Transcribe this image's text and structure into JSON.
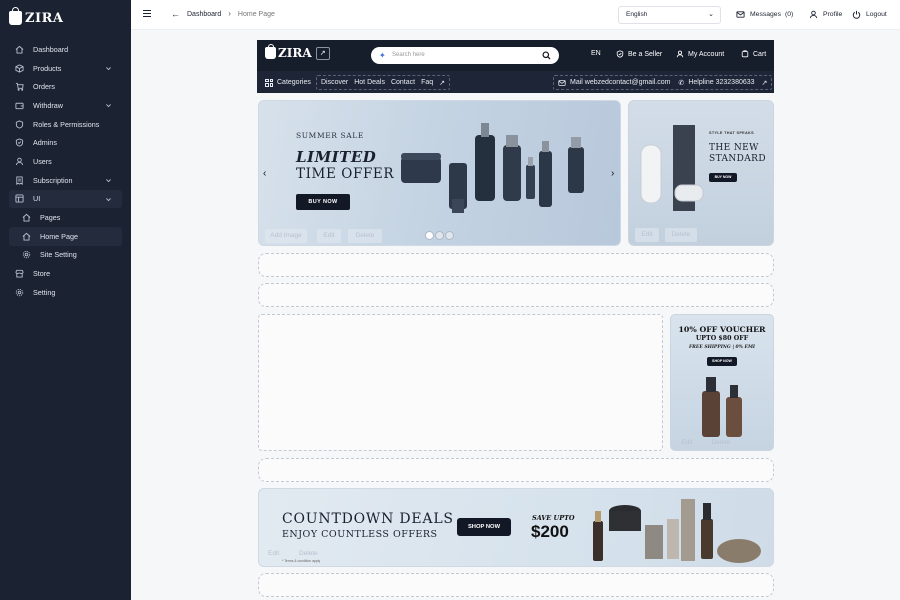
{
  "sidebar": {
    "brand": "ZIRA",
    "items": [
      {
        "label": "Dashboard",
        "icon": "home-icon"
      },
      {
        "label": "Products",
        "icon": "box-icon",
        "expandable": true
      },
      {
        "label": "Orders",
        "icon": "cart-icon"
      },
      {
        "label": "Withdraw",
        "icon": "wallet-icon",
        "expandable": true
      },
      {
        "label": "Roles & Permissions",
        "icon": "shield-icon"
      },
      {
        "label": "Admins",
        "icon": "shield-check-icon"
      },
      {
        "label": "Users",
        "icon": "user-icon"
      },
      {
        "label": "Subscription",
        "icon": "receipt-icon",
        "expandable": true
      },
      {
        "label": "UI",
        "icon": "layout-icon",
        "expandable": true,
        "expanded": true
      },
      {
        "label": "Pages",
        "icon": "home-icon",
        "sub": true
      },
      {
        "label": "Home Page",
        "icon": "home-icon",
        "sub": true,
        "active": true
      },
      {
        "label": "Site Setting",
        "icon": "gear-icon",
        "sub": true
      },
      {
        "label": "Store",
        "icon": "store-icon"
      },
      {
        "label": "Setting",
        "icon": "gear-icon"
      }
    ]
  },
  "topbar": {
    "breadcrumb_parent": "Dashboard",
    "breadcrumb_current": "Home Page",
    "language": "English",
    "messages_label": "Messages",
    "messages_count": "(0)",
    "profile_label": "Profile",
    "logout_label": "Logout"
  },
  "storefront": {
    "brand": "ZIRA",
    "search_placeholder": "Search here",
    "lang": "EN",
    "be_seller": "Be a Seller",
    "my_account": "My Account",
    "cart": "Cart",
    "nav": {
      "categories": "Categories",
      "links": [
        "Discover",
        "Hot Deals",
        "Contact",
        "Faq"
      ],
      "mail": "Mail webzedcontact@gmail.com",
      "helpline": "Helpline 3232380633"
    },
    "hero": {
      "pre_title": "SUMMER SALE",
      "title": "LIMITED",
      "title2": "TIME OFFER",
      "cta": "BUY NOW",
      "add_image": "Add Image",
      "edit": "Edit",
      "delete": "Delete"
    },
    "side_banner": {
      "tag": "STYLE THAT SPEAKS",
      "title": "THE NEW",
      "title2": "STANDARD",
      "cta": "BUY NOW",
      "edit": "Edit",
      "delete": "Delete"
    },
    "voucher": {
      "line1": "10% OFF VOUCHER",
      "line2": "UPTO $80 OFF",
      "line3": "FREE SHIPPING | 0% EMI",
      "cta": "SHOP NOW",
      "edit": "Edit",
      "delete": "Delete"
    },
    "countdown": {
      "title": "COUNTDOWN DEALS",
      "subtitle": "ENJOY COUNTLESS OFFERS",
      "cta": "SHOP NOW",
      "save_label": "SAVE UPTO",
      "price": "$200",
      "fine_print": "* Terms & condition apply",
      "edit": "Edit",
      "delete": "Delete"
    }
  },
  "colors": {
    "sidebar_bg": "#1b2232",
    "store_nav_bg": "#161d2b",
    "accent_dark": "#121826",
    "page_bg": "#f6f7f9"
  }
}
